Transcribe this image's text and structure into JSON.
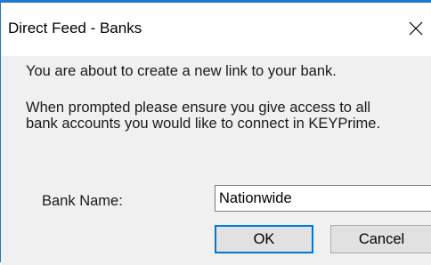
{
  "window": {
    "title": "Direct Feed - Banks",
    "close_glyph": "close-icon"
  },
  "message": {
    "line1": "You are about to create a new link to your bank.",
    "line2": "When prompted please ensure you give access to all",
    "line3": "bank accounts you would like to connect in KEYPrime."
  },
  "form": {
    "bank_name_label": "Bank Name:",
    "bank_name_value": "Nationwide"
  },
  "buttons": {
    "ok_label": "OK",
    "cancel_label": "Cancel"
  },
  "colors": {
    "accent": "#0078d7",
    "window_border": "#1f79d1",
    "dialog_background": "#f0f0f0"
  }
}
